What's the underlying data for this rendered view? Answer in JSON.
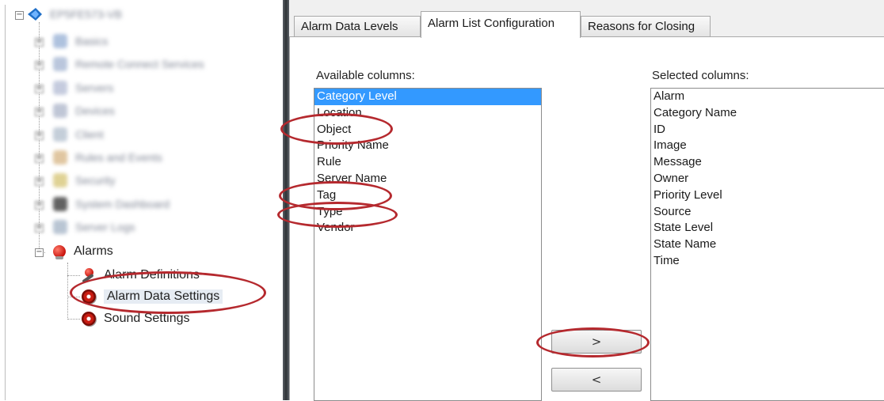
{
  "tree": {
    "root_label": "EP5FE573-VB",
    "blurred_items": [
      {
        "label": "Basics",
        "icon": "blue-square-icon",
        "color": "#9bb3d6"
      },
      {
        "label": "Remote Connect Services",
        "icon": "cloud-icon",
        "color": "#a9b9d4"
      },
      {
        "label": "Servers",
        "icon": "server-icon",
        "color": "#b7bfd6"
      },
      {
        "label": "Devices",
        "icon": "camera-icon",
        "color": "#b0b8cc"
      },
      {
        "label": "Client",
        "icon": "monitor-icon",
        "color": "#b6c2d0"
      },
      {
        "label": "Rules and Events",
        "icon": "rules-icon",
        "color": "#d9b98a"
      },
      {
        "label": "Security",
        "icon": "lock-icon",
        "color": "#d8c77a"
      },
      {
        "label": "System Dashboard",
        "icon": "dashboard-icon",
        "color": "#3c3c3c"
      },
      {
        "label": "Server Logs",
        "icon": "log-icon",
        "color": "#a8b7c9"
      }
    ],
    "alarms": {
      "label": "Alarms",
      "children": [
        {
          "label": "Alarm Definitions",
          "icon": "alarm-definition-icon"
        },
        {
          "label": "Alarm Data Settings",
          "icon": "alarm-data-icon"
        },
        {
          "label": "Sound Settings",
          "icon": "sound-icon"
        }
      ]
    }
  },
  "tabs": [
    {
      "label": "Alarm Data Levels",
      "active": false
    },
    {
      "label": "Alarm List Configuration",
      "active": true
    },
    {
      "label": "Reasons for Closing",
      "active": false
    }
  ],
  "available": {
    "label": "Available columns:",
    "items": [
      "Category Level",
      "Location",
      "Object",
      "Priority Name",
      "Rule",
      "Server Name",
      "Tag",
      "Type",
      "Vendor"
    ],
    "selected_item": "Category Level"
  },
  "selected": {
    "label": "Selected columns:",
    "items": [
      "Alarm",
      "Category Name",
      "ID",
      "Image",
      "Message",
      "Owner",
      "Priority Level",
      "Source",
      "State Level",
      "State Name",
      "Time"
    ]
  },
  "buttons": {
    "add_label": ">",
    "remove_label": "<"
  },
  "colors": {
    "annotation": "#b5292e",
    "selection": "#3399ff"
  }
}
